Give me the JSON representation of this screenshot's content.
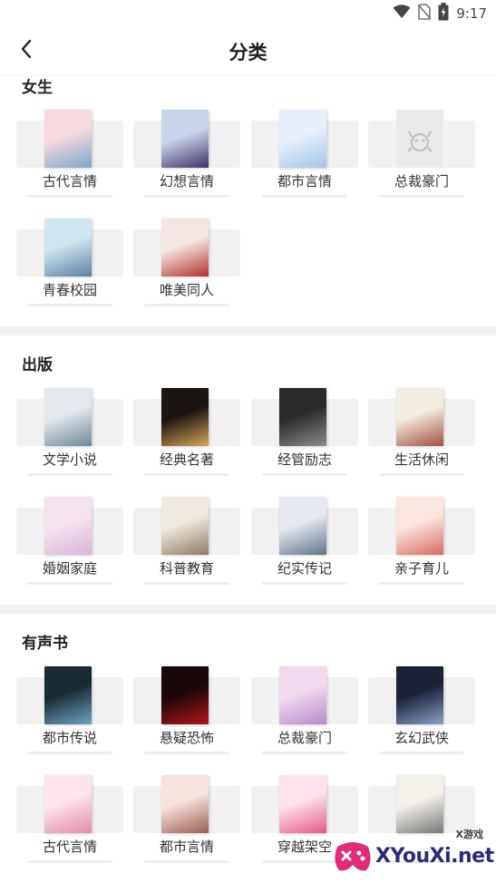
{
  "status_bar": {
    "time": "9:17",
    "icons": [
      "wifi-icon",
      "no-sim-icon",
      "battery-icon"
    ]
  },
  "header": {
    "title": "分类",
    "back_icon": "chevron-left-icon"
  },
  "sections": [
    {
      "title": "女生",
      "items": [
        {
          "label": "古代言情",
          "cover_colors": [
            "#f6d9de",
            "#7aa7c9"
          ]
        },
        {
          "label": "幻想言情",
          "cover_colors": [
            "#c9d6ea",
            "#40306a"
          ]
        },
        {
          "label": "都市言情",
          "cover_colors": [
            "#e6effa",
            "#a3c7e6"
          ]
        },
        {
          "label": "总裁豪门",
          "cover_colors": [
            "#e9e9e9",
            "#d0d0d0"
          ]
        },
        {
          "label": "青春校园",
          "cover_colors": [
            "#cfe5ef",
            "#5a7fa0"
          ]
        },
        {
          "label": "唯美同人",
          "cover_colors": [
            "#f4e6e2",
            "#b3312a"
          ]
        }
      ]
    },
    {
      "title": "出版",
      "items": [
        {
          "label": "文学小说",
          "cover_colors": [
            "#e3e8ec",
            "#6d8797"
          ]
        },
        {
          "label": "经典名著",
          "cover_colors": [
            "#1a1510",
            "#d8a65a"
          ]
        },
        {
          "label": "经管励志",
          "cover_colors": [
            "#2a2a2a",
            "#8c8c8c"
          ]
        },
        {
          "label": "生活休闲",
          "cover_colors": [
            "#f3ece0",
            "#a14f40"
          ]
        },
        {
          "label": "婚姻家庭",
          "cover_colors": [
            "#f5e2ef",
            "#d9b6d8"
          ]
        },
        {
          "label": "科普教育",
          "cover_colors": [
            "#efe8de",
            "#8d7b66"
          ]
        },
        {
          "label": "纪实传记",
          "cover_colors": [
            "#e5e8ee",
            "#62748c"
          ]
        },
        {
          "label": "亲子育儿",
          "cover_colors": [
            "#fae5e0",
            "#d96b5f"
          ]
        }
      ]
    },
    {
      "title": "有声书",
      "items": [
        {
          "label": "都市传说",
          "cover_colors": [
            "#1a2a33",
            "#6ba6c2"
          ]
        },
        {
          "label": "悬疑恐怖",
          "cover_colors": [
            "#1a0808",
            "#b3151a"
          ]
        },
        {
          "label": "总裁豪门",
          "cover_colors": [
            "#f1d9ee",
            "#b48cc8"
          ]
        },
        {
          "label": "玄幻武侠",
          "cover_colors": [
            "#1b2236",
            "#8aa0c8"
          ]
        },
        {
          "label": "古代言情",
          "cover_colors": [
            "#fbe4ec",
            "#e38aa8"
          ]
        },
        {
          "label": "都市言情",
          "cover_colors": [
            "#f6e3de",
            "#9b5d50"
          ]
        },
        {
          "label": "穿越架空",
          "cover_colors": [
            "#fde2ea",
            "#e25a86"
          ]
        },
        {
          "label": "",
          "cover_colors": [
            "#f3f0ea",
            "#777777"
          ]
        }
      ]
    }
  ],
  "watermark": {
    "brand": "XYouXi.net",
    "tag": "X游戏"
  }
}
